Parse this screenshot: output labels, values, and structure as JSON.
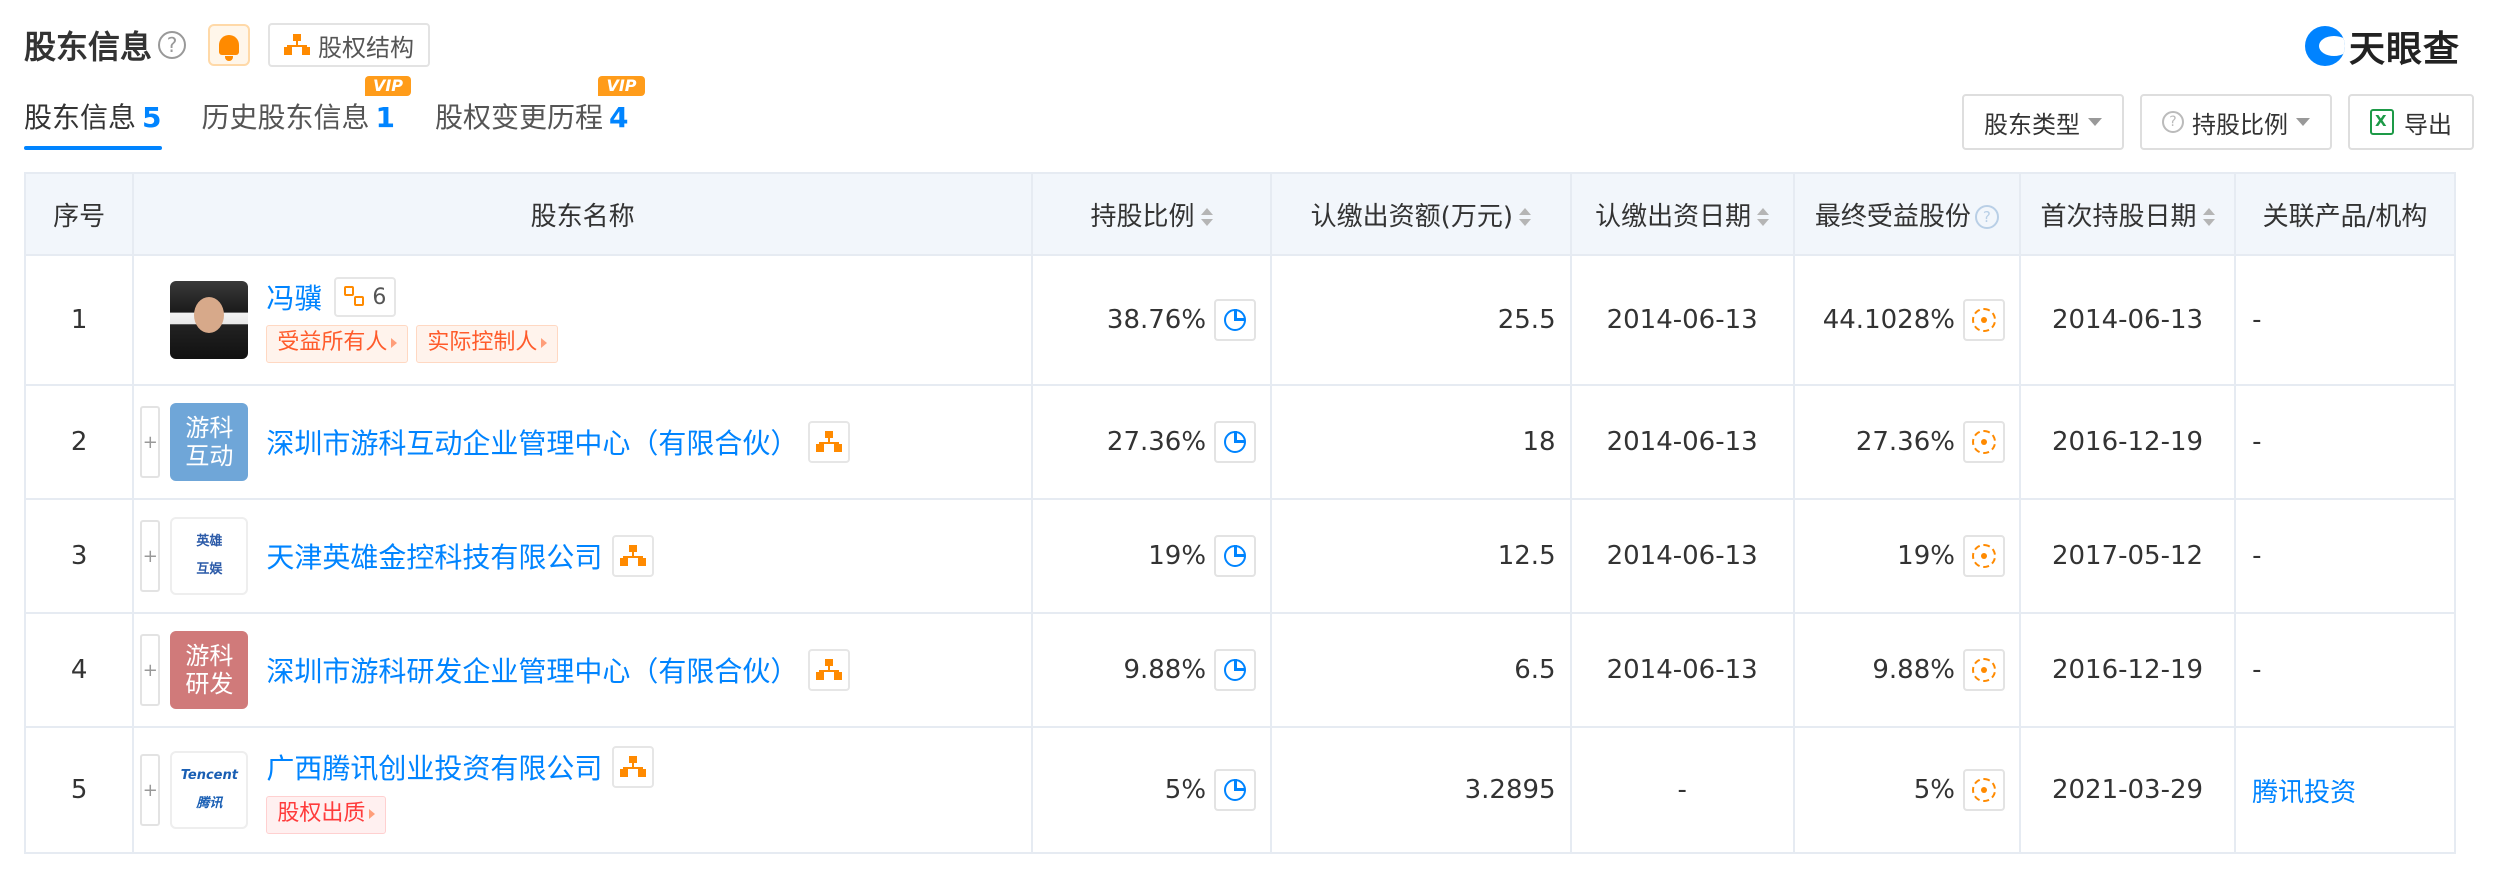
{
  "header": {
    "title": "股东信息",
    "help_glyph": "?",
    "structure_button": "股权结构",
    "logo_text": "天眼查"
  },
  "tabs": [
    {
      "label": "股东信息",
      "count": "5",
      "active": true,
      "vip": ""
    },
    {
      "label": "历史股东信息",
      "count": "1",
      "active": false,
      "vip": "VIP"
    },
    {
      "label": "股权变更历程",
      "count": "4",
      "active": false,
      "vip": "VIP"
    }
  ],
  "toolbar": {
    "shareholder_type": "股东类型",
    "holding_ratio": "持股比例",
    "export": "导出"
  },
  "table": {
    "headers": {
      "index": "序号",
      "name": "股东名称",
      "ratio": "持股比例",
      "subscribed_amount": "认缴出资额(万元)",
      "subscribed_date": "认缴出资日期",
      "final_beneficial": "最终受益股份",
      "first_holding_date": "首次持股日期",
      "related": "关联产品/机构"
    },
    "rows": [
      {
        "index": "1",
        "name": "冯骥",
        "avatar_text": "",
        "relation_count": "6",
        "tags": [
          "受益所有人",
          "实际控制人"
        ],
        "ratio": "38.76%",
        "amount": "25.5",
        "sub_date": "2014-06-13",
        "beneficial": "44.1028%",
        "first_date": "2014-06-13",
        "related": "-"
      },
      {
        "index": "2",
        "name": "深圳市游科互动企业管理中心（有限合伙）",
        "avatar_text": "游科互动",
        "tags": [],
        "ratio": "27.36%",
        "amount": "18",
        "sub_date": "2014-06-13",
        "beneficial": "27.36%",
        "first_date": "2016-12-19",
        "related": "-"
      },
      {
        "index": "3",
        "name": "天津英雄金控科技有限公司",
        "avatar_text": "英雄互娱",
        "tags": [],
        "ratio": "19%",
        "amount": "12.5",
        "sub_date": "2014-06-13",
        "beneficial": "19%",
        "first_date": "2017-05-12",
        "related": "-"
      },
      {
        "index": "4",
        "name": "深圳市游科研发企业管理中心（有限合伙）",
        "avatar_text": "游科研发",
        "tags": [],
        "ratio": "9.88%",
        "amount": "6.5",
        "sub_date": "2014-06-13",
        "beneficial": "9.88%",
        "first_date": "2016-12-19",
        "related": "-"
      },
      {
        "index": "5",
        "name": "广西腾讯创业投资有限公司",
        "avatar_text": "Tencent 腾讯",
        "tags": [
          "股权出质"
        ],
        "ratio": "5%",
        "amount": "3.2895",
        "sub_date": "-",
        "beneficial": "5%",
        "first_date": "2021-03-29",
        "related": "腾讯投资"
      }
    ]
  },
  "colors": {
    "accent_blue": "#0084ff",
    "orange": "#ff8a00",
    "tag_red": "#ff3b3b",
    "header_bg": "#f2f6fb",
    "avatar_youke_hudong": "#6fa6d8",
    "avatar_youke_yanfa": "#d07a7a"
  },
  "icons": [
    "help-icon",
    "bell-icon",
    "org-structure-icon",
    "relation-icon",
    "pie-chart-icon",
    "penetration-icon",
    "excel-icon",
    "sort-icon",
    "expand-icon"
  ]
}
